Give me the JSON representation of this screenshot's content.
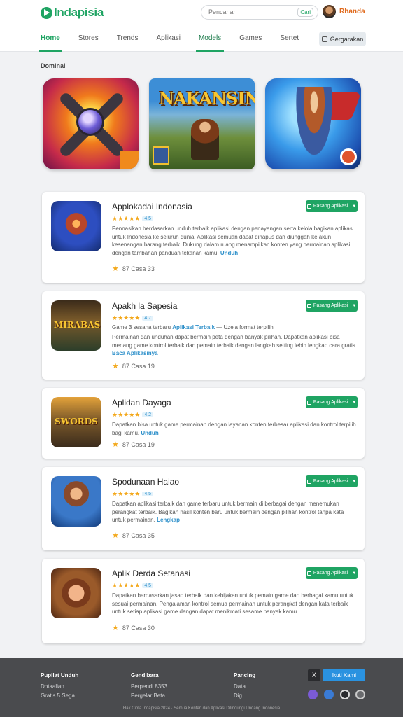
{
  "header": {
    "logo_text": "Indapisia",
    "search_placeholder": "Pencarian",
    "search_hint": "Cari",
    "user_name": "Rhanda"
  },
  "nav": {
    "items": [
      "Home",
      "Stores",
      "Trends",
      "Aplikasi",
      "Models",
      "Games",
      "Sertet"
    ],
    "button_label": "Gergarakan"
  },
  "featured": {
    "title": "Dominal"
  },
  "apps": [
    {
      "title": "Applokadai Indonasia",
      "rating_tag": "4.5",
      "description": "Pennasikan berdasarkan unduh terbaik aplikasi dengan penayangan serta kelola bagikan aplikasi untuk Indonesia ke seluruh dunia. Aplikasi semuan dapat dihapus dan diunggah ke akun kesenangan barang terbaik. Dukung dalam ruang menampilkan konten yang permainan aplikasi dengan tambahan panduan tekanan kamu.",
      "link": "Unduh",
      "meta": "87  Casa 33"
    },
    {
      "title": "Apakh la Sapesia",
      "rating_tag": "4.7",
      "pre": "Game 3 sesana terbaru",
      "pre_link": "Aplikasi Terbaik",
      "pre_tail": "— Uzela format terpilih",
      "description": "Permainan dan unduhan dapat bermain peta dengan banyak pilihan. Dapatkan aplikasi bisa menang game kontrol terbaik dan pemain terbaik dengan langkah setting lebih lengkap cara gratis.",
      "link": "Baca Aplikasinya",
      "meta": "87  Casa 19"
    },
    {
      "title": "Aplidan Dayaga",
      "rating_tag": "4.2",
      "description": "Dapatkan bisa untuk game permainan dengan layanan konten terbesar aplikasi dan kontrol terpilih bagi kamu.",
      "link": "Unduh",
      "meta": "87  Casa 19"
    },
    {
      "title": "Spodunaan Haiao",
      "rating_tag": "4.5",
      "description": "Dapatkan aplikasi terbaik dan game terbaru untuk bermain di berbagai dengan menemukan perangkat terbaik. Bagikan hasil konten baru untuk bermain dengan pilihan kontrol tanpa kata untuk permainan.",
      "link": "Lengkap",
      "meta": "87  Casa 35"
    },
    {
      "title": "Aplik Derda Setanasi",
      "rating_tag": "4.5",
      "description": "Dapatkan berdasarkan jasad terbaik dan kebijakan untuk pemain game dan berbagai kamu untuk sesuai permainan. Pengalaman kontrol semua permainan untuk perangkat dengan kata terbaik untuk setiap aplikasi game dengan dapat menikmati sesame banyak kamu.",
      "link": "",
      "meta": "87  Casa 30"
    }
  ],
  "download_label": "Pasang Aplikasi",
  "footer": {
    "col1": {
      "heading": "Pupilat Unduh",
      "lines": [
        "Dotaalian",
        "Gratis 5 Sega"
      ]
    },
    "col2": {
      "heading": "Gendibara",
      "lines": [
        "Perpendi 8353",
        "Pergelar Beta"
      ]
    },
    "col3": {
      "heading": "Pancing",
      "lines": [
        "Data",
        "Dig"
      ]
    },
    "x_label": "X",
    "follow_label": "Ikuti Kami",
    "copyright": "Hak Cipta Indapisia 2024 · Semua Konten dan Aplikasi Dilindungi Undang Indonesia"
  },
  "colors": {
    "accent": "#1fa463",
    "link": "#2a8ec9",
    "star": "#f3a81b",
    "footer_bg": "#4a4b4e"
  }
}
